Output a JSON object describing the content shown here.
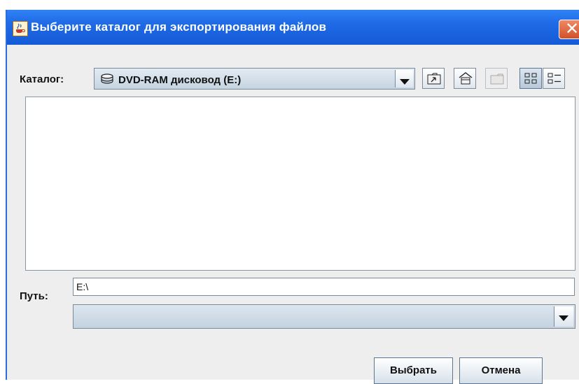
{
  "window": {
    "title": "Выберите каталог для экспортирования файлов"
  },
  "icons": {
    "app": "java-coffee-icon",
    "close": "close-icon",
    "drive": "dvd-drive-icon",
    "up_folder": "up-folder-icon",
    "home": "home-icon",
    "new_folder": "new-folder-icon",
    "list_view": "list-view-icon",
    "details_view": "details-view-icon",
    "dropdown": "chevron-down-icon"
  },
  "directory": {
    "label": "Каталог:",
    "selected": "DVD-RAM дисковод (E:)"
  },
  "path": {
    "label": "Путь:",
    "value": "E:\\"
  },
  "filter": {
    "selected": ""
  },
  "buttons": {
    "select": "Выбрать",
    "cancel": "Отмена"
  },
  "colors": {
    "titlebar": "#1f6ae6",
    "close": "#d2502a"
  }
}
